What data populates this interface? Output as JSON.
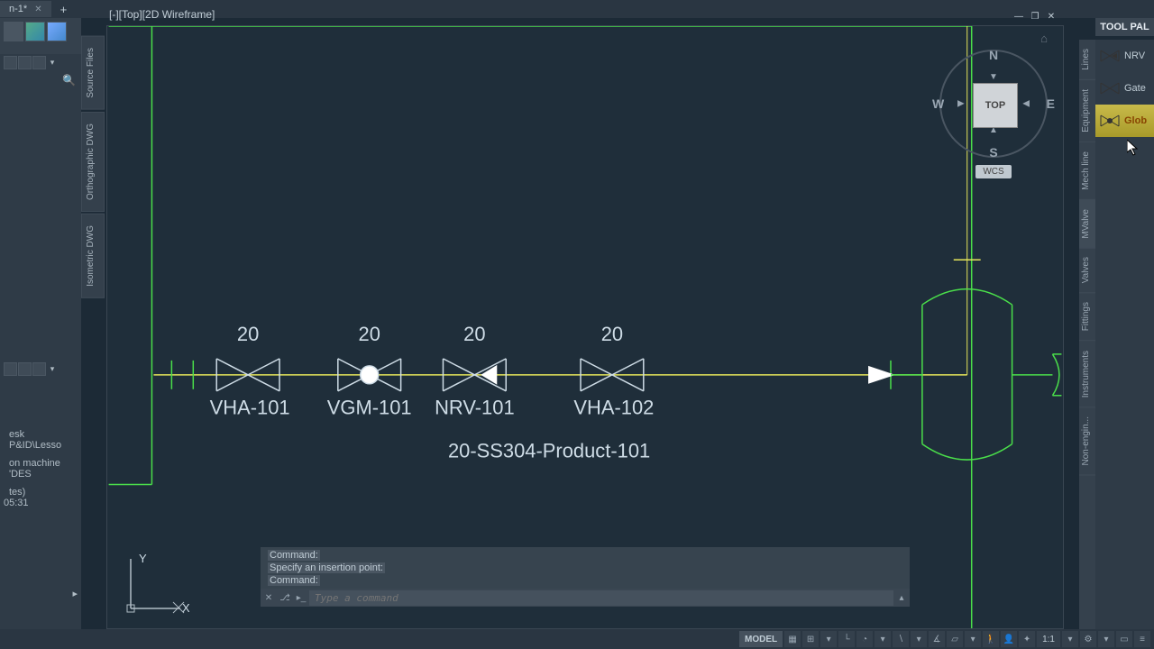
{
  "tab": {
    "label": "n-1*"
  },
  "viewport": {
    "label": "[-][Top][2D Wireframe]"
  },
  "side_tabs": {
    "source_files": "Source Files",
    "ortho_dwg": "Orthographic DWG",
    "iso_dwg": "Isometric DWG"
  },
  "left_panel": {
    "text_line1": "esk P&ID\\Lesso",
    "text_line2": "on machine 'DES",
    "text_line3": "tes)",
    "timestamp": "05:31"
  },
  "nav": {
    "n": "N",
    "s": "S",
    "w": "W",
    "e": "E",
    "cube_face": "TOP",
    "wcs": "WCS"
  },
  "command": {
    "line1": "Command:",
    "line2": "Specify an insertion point:",
    "line3": "Command:",
    "placeholder": "Type a command"
  },
  "ucs": {
    "x": "X",
    "y": "Y"
  },
  "status": {
    "model": "MODEL",
    "scale": "1:1"
  },
  "tool_palette": {
    "title": "TOOL PAL",
    "items": [
      {
        "label": "NRV"
      },
      {
        "label": "Gate"
      },
      {
        "label": "Glob"
      }
    ],
    "cats": [
      "Lines",
      "Equipment",
      "Mech line",
      "MValve",
      "Valves",
      "Fittings",
      "Instruments",
      "Non-engin..."
    ]
  },
  "diagram": {
    "sizes": [
      "20",
      "20",
      "20",
      "20"
    ],
    "tags": [
      "VHA-101",
      "VGM-101",
      "NRV-101",
      "VHA-102"
    ],
    "line_tag": "20-SS304-Product-101"
  },
  "chart_data": {
    "type": "diagram",
    "description": "P&ID process flow line with valves connecting to vessel",
    "line_spec": "20-SS304-Product-101",
    "components": [
      {
        "type": "gate_valve",
        "tag": "VHA-101",
        "size": 20,
        "order": 1
      },
      {
        "type": "globe_valve",
        "tag": "VGM-101",
        "size": 20,
        "order": 2
      },
      {
        "type": "check_valve",
        "tag": "NRV-101",
        "size": 20,
        "order": 3
      },
      {
        "type": "gate_valve",
        "tag": "VHA-102",
        "size": 20,
        "order": 4
      },
      {
        "type": "flow_arrow",
        "order": 5
      },
      {
        "type": "vessel",
        "order": 6
      }
    ]
  }
}
